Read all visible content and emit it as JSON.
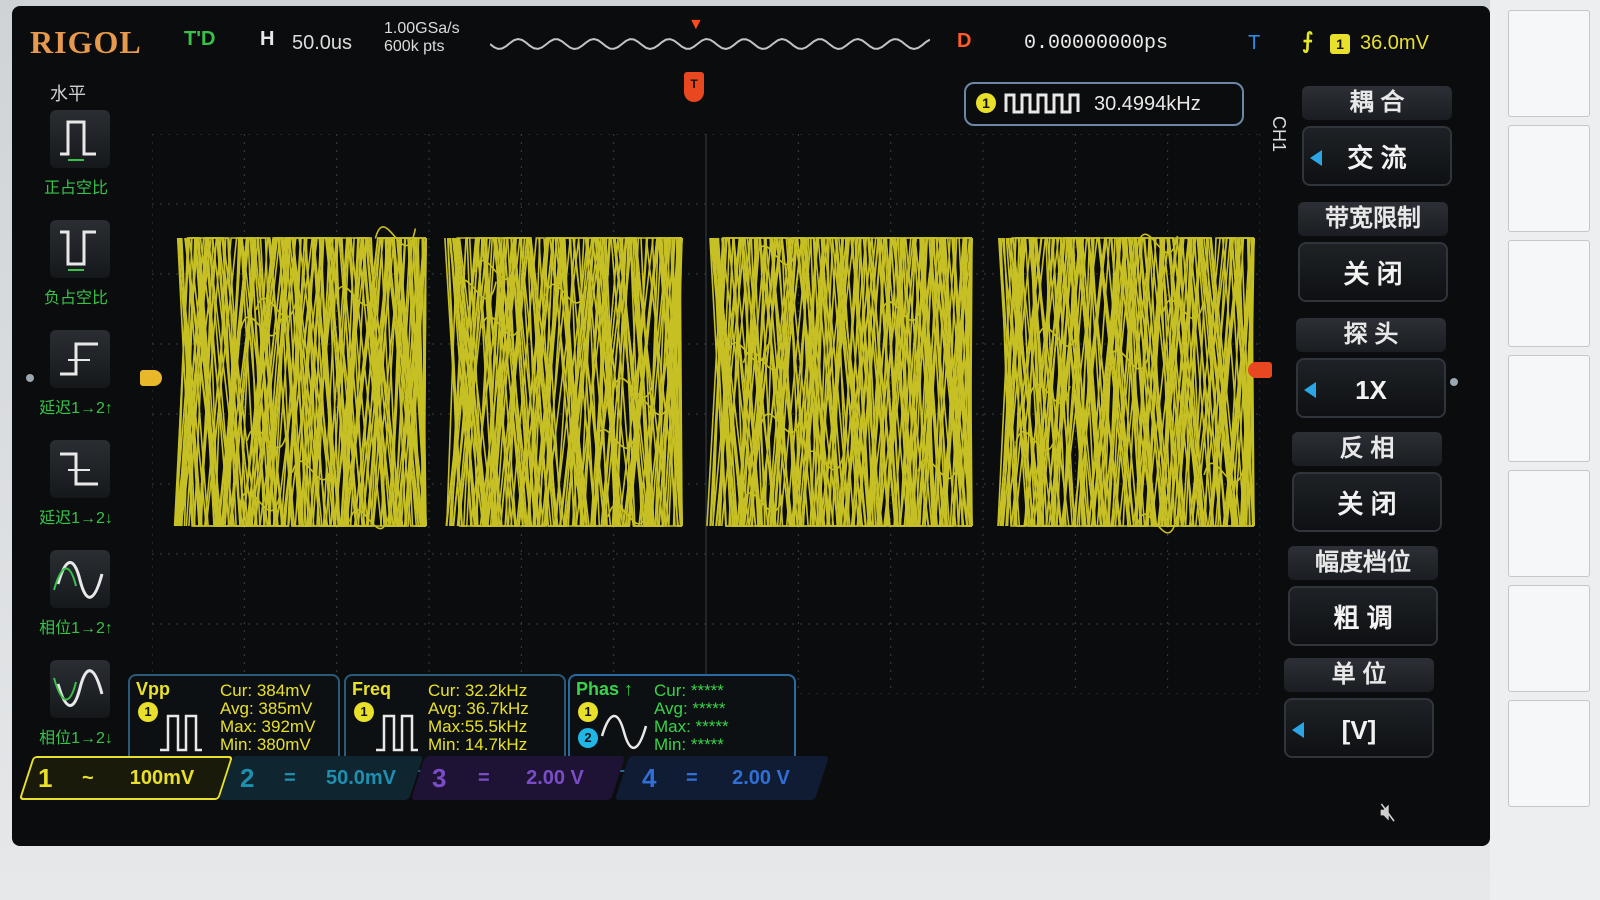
{
  "header": {
    "brand": "RIGOL",
    "run_status": "T'D",
    "horizontal_icon": "H",
    "timebase": "50.0us",
    "sample_rate": "1.00GSa/s",
    "memory_depth": "600k pts",
    "delay_badge": "D",
    "delay_value": "0.00000000ps",
    "trigger_type": "T",
    "trigger_edge": "⨍",
    "trigger_channel": "1",
    "trigger_level": "36.0mV"
  },
  "frequency_counter": {
    "channel": "1",
    "value": "30.4994kHz"
  },
  "left_panel": {
    "title": "水平",
    "items": [
      {
        "label": "正占空比",
        "icon": "positive-duty-icon"
      },
      {
        "label": "负占空比",
        "icon": "negative-duty-icon"
      },
      {
        "label": "延迟1→2↑",
        "icon": "delay-rise-icon"
      },
      {
        "label": "延迟1→2↓",
        "icon": "delay-fall-icon"
      },
      {
        "label": "相位1→2↑",
        "icon": "phase-rise-icon"
      },
      {
        "label": "相位1→2↓",
        "icon": "phase-fall-icon"
      }
    ]
  },
  "right_menu": {
    "channel_label": "CH1",
    "sections": [
      {
        "title": "耦 合",
        "value": "交 流",
        "arrow": true
      },
      {
        "title": "带宽限制",
        "value": "关 闭",
        "arrow": false
      },
      {
        "title": "探 头",
        "value": "1X",
        "arrow": true
      },
      {
        "title": "反 相",
        "value": "关 闭",
        "arrow": false
      },
      {
        "title": "幅度档位",
        "value": "粗 调",
        "arrow": false
      },
      {
        "title": "单 位",
        "value": "[V]",
        "arrow": true
      }
    ]
  },
  "measurements": {
    "vpp": {
      "title": "Vpp",
      "channel": "1",
      "cur": "Cur: 384mV",
      "avg": "Avg: 385mV",
      "max": "Max: 392mV",
      "min": "Min: 380mV"
    },
    "freq": {
      "title": "Freq",
      "channel": "1",
      "cur": "Cur: 32.2kHz",
      "avg": "Avg: 36.7kHz",
      "max": "Max:55.5kHz",
      "min": "Min: 14.7kHz"
    },
    "phase": {
      "title": "Phas ↑",
      "channel_a": "1",
      "channel_b": "2",
      "cur": "Cur: *****",
      "avg": "Avg: *****",
      "max": "Max: *****",
      "min": "Min: *****"
    }
  },
  "channels": [
    {
      "num": "1",
      "coupling": "~",
      "scale": "100mV",
      "color": "#e8e02a"
    },
    {
      "num": "2",
      "coupling": "=",
      "scale": "50.0mV",
      "color": "#1f8fb0"
    },
    {
      "num": "3",
      "coupling": "=",
      "scale": "2.00 V",
      "color": "#7a4cc8"
    },
    {
      "num": "4",
      "coupling": "=",
      "scale": "2.00 V",
      "color": "#2f6fd6"
    }
  ],
  "colors": {
    "ch1": "#e8e02a",
    "grid": "#3a3f44",
    "accent_orange": "#e8471f",
    "menu_arrow": "#2aa6e6"
  },
  "icons": {
    "speaker": "speaker-muted-icon"
  }
}
